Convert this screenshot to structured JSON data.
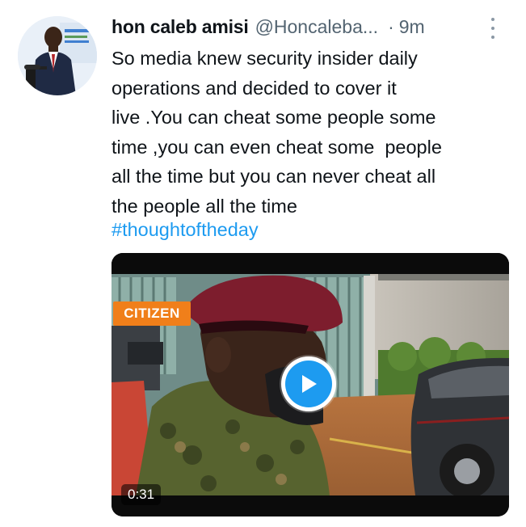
{
  "tweet": {
    "author_name": "hon caleb amisi",
    "handle": "@Honcaleba...",
    "separator": "·",
    "time": "9m",
    "text": "So media knew security insider daily\noperations and decided to cover it\nlive .You can cheat some people some\ntime ,you can even cheat some  people\nall the time but you can never cheat all\nthe people all the time",
    "hashtag": "#thoughtoftheday"
  },
  "media": {
    "type": "video",
    "duration": "0:31",
    "logo_text": "CITIZEN"
  },
  "icons": {
    "more": "more-vertical-icon",
    "play": "play-icon"
  },
  "colors": {
    "link": "#1d9bf0",
    "text": "#0f1419",
    "secondary": "#536471",
    "logo": "#f07f1a"
  }
}
